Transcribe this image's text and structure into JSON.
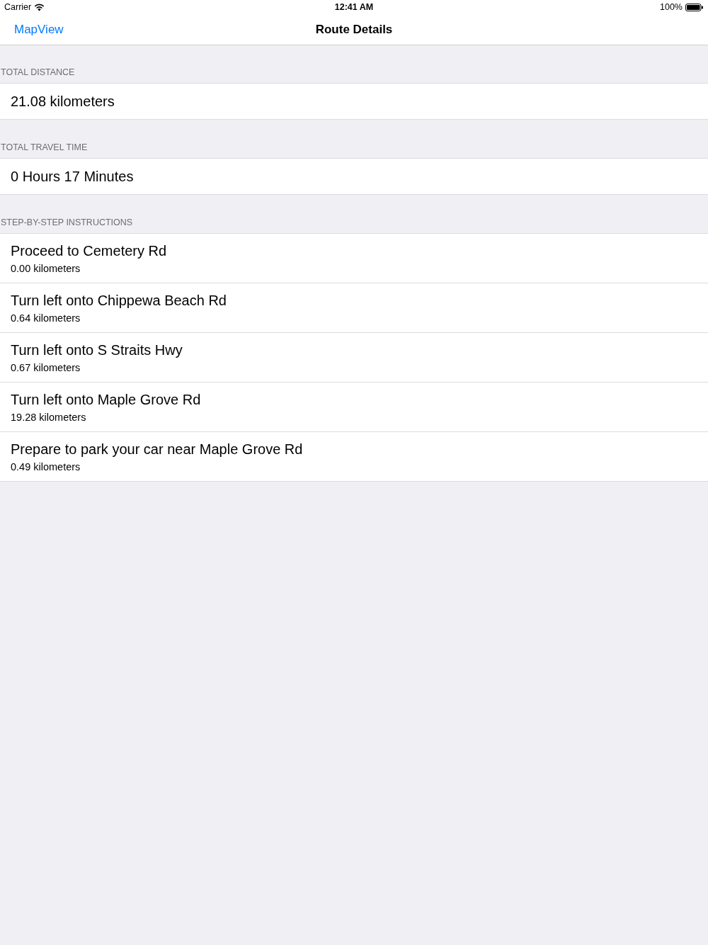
{
  "status_bar": {
    "carrier": "Carrier",
    "time": "12:41 AM",
    "battery": "100%"
  },
  "nav_bar": {
    "back": "MapView",
    "title": "Route Details"
  },
  "sections": [
    {
      "header": "TOTAL DISTANCE",
      "rows": [
        {
          "kind": "value",
          "title": "21.08 kilometers"
        }
      ]
    },
    {
      "header": "TOTAL TRAVEL TIME",
      "rows": [
        {
          "kind": "value",
          "title": "0 Hours 17 Minutes"
        }
      ]
    },
    {
      "header": "STEP-BY-STEP INSTRUCTIONS",
      "rows": [
        {
          "kind": "step",
          "title": "Proceed to Cemetery Rd",
          "detail": "0.00 kilometers"
        },
        {
          "kind": "step",
          "title": "Turn left onto Chippewa Beach Rd",
          "detail": "0.64 kilometers"
        },
        {
          "kind": "step",
          "title": "Turn left onto S Straits Hwy",
          "detail": "0.67 kilometers"
        },
        {
          "kind": "step",
          "title": "Turn left onto Maple Grove Rd",
          "detail": "19.28 kilometers"
        },
        {
          "kind": "step",
          "title": "Prepare to park your car near Maple Grove Rd",
          "detail": "0.49 kilometers"
        }
      ]
    }
  ]
}
